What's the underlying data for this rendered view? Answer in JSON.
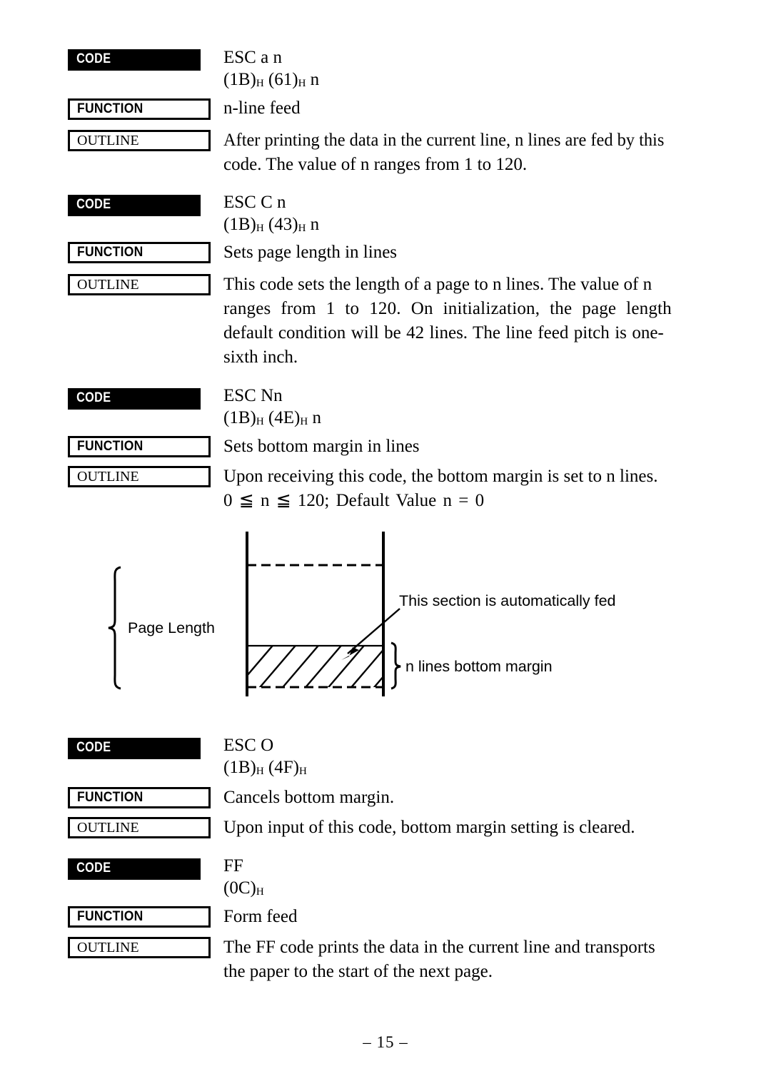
{
  "page": {
    "footer": "– 15 –"
  },
  "labels": {
    "code": "CODE",
    "function": "FUNCTION",
    "outline": "OUTLINE"
  },
  "blocks": [
    {
      "id": "esc-a-n",
      "code_mnemonic": "ESC a n",
      "code_hex_prefix": "(1B)",
      "code_hex_sub1": "H",
      "code_hex_mid": " (61)",
      "code_hex_sub2": "H",
      "code_hex_suffix": " n",
      "function": "n-line feed",
      "outline_line1": "After printing the data in the current line, n lines are fed by this",
      "outline_line2": "code. The value of n ranges from 1 to 120."
    },
    {
      "id": "esc-c-n",
      "code_mnemonic": "ESC C n",
      "code_hex_prefix": "(1B)",
      "code_hex_sub1": "H",
      "code_hex_mid": " (43)",
      "code_hex_sub2": "H",
      "code_hex_suffix": " n",
      "function": "Sets page length in lines",
      "outline_line1": "This code sets the length of a page to n lines. The value of n",
      "outline_line2": "ranges from 1 to 120. On initialization, the page length",
      "outline_line3": "default condition will be 42 lines. The line feed pitch is one-",
      "outline_line4": "sixth inch."
    },
    {
      "id": "esc-n-n",
      "code_mnemonic": "ESC Nn",
      "code_hex_prefix": "(1B)",
      "code_hex_sub1": "H",
      "code_hex_mid": " (4E)",
      "code_hex_sub2": "H",
      "code_hex_suffix": " n",
      "function": "Sets bottom margin in lines",
      "outline_line1": "Upon receiving this code, the bottom margin is set to n lines.",
      "outline_line2": "0 ≦ n ≦ 120; Default Value n = 0"
    },
    {
      "id": "esc-o",
      "code_mnemonic": "ESC O",
      "code_hex_prefix": "(1B)",
      "code_hex_sub1": "H",
      "code_hex_mid": " (4F)",
      "code_hex_sub2": "H",
      "code_hex_suffix": "",
      "function": "Cancels bottom margin.",
      "outline_line1": "Upon input of this code, bottom margin setting is cleared."
    },
    {
      "id": "ff",
      "code_mnemonic": "FF",
      "code_hex_prefix": "(0C)",
      "code_hex_sub1": "H",
      "code_hex_mid": "",
      "code_hex_sub2": "",
      "code_hex_suffix": "",
      "function": "Form feed",
      "outline_line1": "The FF code prints the data in the current line and transports",
      "outline_line2": "the paper to the start of the next page."
    }
  ],
  "diagram": {
    "page_length_label": "Page Length",
    "auto_fed_label": "This section is automatically fed",
    "bottom_margin_label": "n lines bottom margin"
  }
}
